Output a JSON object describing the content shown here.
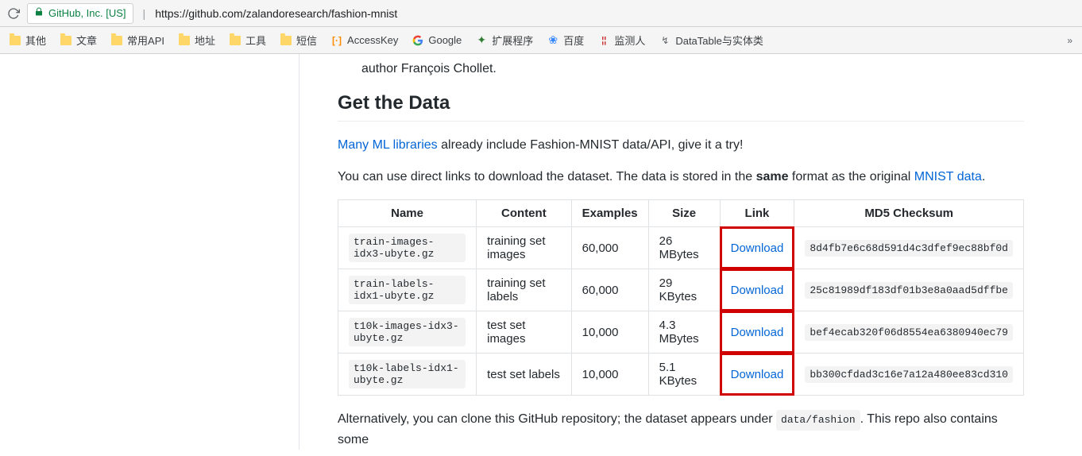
{
  "browser": {
    "org": "GitHub, Inc. [US]",
    "url": "https://github.com/zalandoresearch/fashion-mnist"
  },
  "bookmarks": {
    "items": [
      {
        "label": "其他"
      },
      {
        "label": "文章"
      },
      {
        "label": "常用API"
      },
      {
        "label": "地址"
      },
      {
        "label": "工具"
      },
      {
        "label": "短信"
      }
    ],
    "accesskey": "AccessKey",
    "google": "Google",
    "ext": "扩展程序",
    "baidu": "百度",
    "monitor": "监测人",
    "dt": "DataTable与实体类"
  },
  "readme": {
    "author_line": "author François Chollet.",
    "heading": "Get the Data",
    "para1_link": "Many ML libraries",
    "para1_rest": " already include Fashion-MNIST data/API, give it a try!",
    "para2_a": "You can use direct links to download the dataset. The data is stored in the ",
    "para2_same": "same",
    "para2_b": " format as the original ",
    "para2_link": "MNIST data",
    "para2_dot": ".",
    "table": {
      "headers": [
        "Name",
        "Content",
        "Examples",
        "Size",
        "Link",
        "MD5 Checksum"
      ],
      "rows": [
        {
          "name": "train-images-idx3-ubyte.gz",
          "content": "training set images",
          "examples": "60,000",
          "size": "26 MBytes",
          "link": "Download",
          "md5": "8d4fb7e6c68d591d4c3dfef9ec88bf0d"
        },
        {
          "name": "train-labels-idx1-ubyte.gz",
          "content": "training set labels",
          "examples": "60,000",
          "size": "29 KBytes",
          "link": "Download",
          "md5": "25c81989df183df01b3e8a0aad5dffbe"
        },
        {
          "name": "t10k-images-idx3-ubyte.gz",
          "content": "test set images",
          "examples": "10,000",
          "size": "4.3 MBytes",
          "link": "Download",
          "md5": "bef4ecab320f06d8554ea6380940ec79"
        },
        {
          "name": "t10k-labels-idx1-ubyte.gz",
          "content": "test set labels",
          "examples": "10,000",
          "size": "5.1 KBytes",
          "link": "Download",
          "md5": "bb300cfdad3c16e7a12a480ee83cd310"
        }
      ]
    },
    "footer_a": "Alternatively, you can clone this GitHub repository; the dataset appears under ",
    "footer_code": "data/fashion",
    "footer_b": ". This repo also contains some"
  }
}
